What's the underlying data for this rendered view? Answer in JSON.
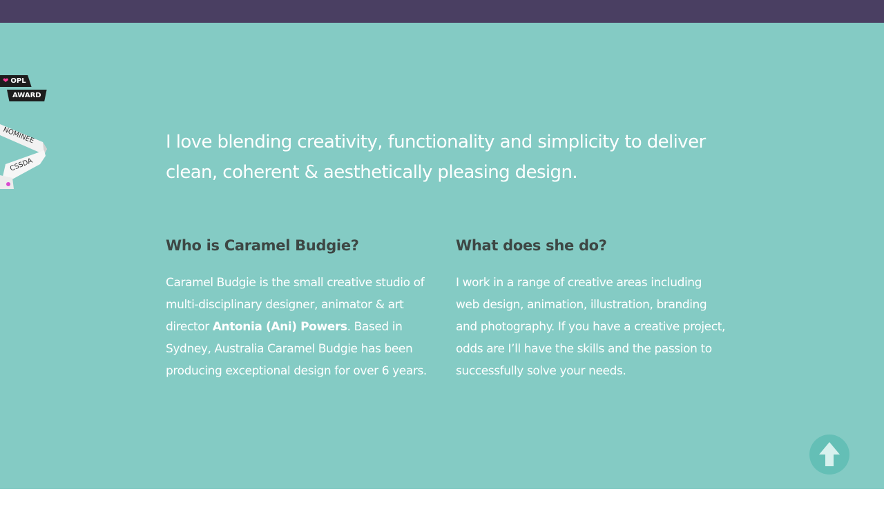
{
  "colors": {
    "topbar": "#4a3f62",
    "main_bg": "#84cbc4",
    "heading": "#3d4744",
    "to_top_button": "#64bfb6"
  },
  "badges": {
    "opl_top": "OPL",
    "opl_bottom": "AWARD",
    "cssda_nominee": "NOMINEE",
    "cssda_name": "CSSDA"
  },
  "intro": {
    "line1": "I love blending creativity, functionality and simplicity to deliver",
    "line2": "clean, coherent & aesthetically pleasing design."
  },
  "who": {
    "heading": "Who is Caramel Budgie?",
    "text_before": "Caramel Budgie is the small creative studio of multi-disciplinary designer, animator & art director ",
    "name": "Antonia (Ani) Powers",
    "text_after": ". Based in Sydney, Australia Caramel Budgie has been producing exceptional design for over 6 years."
  },
  "what": {
    "heading": "What does she do?",
    "text": "I work in a range of creative areas including web design, animation, illustration, branding and photography. If you have a creative project, odds are I’ll have the skills and the passion to successfully solve your needs."
  },
  "to_top": {
    "icon": "arrow-up-icon"
  }
}
